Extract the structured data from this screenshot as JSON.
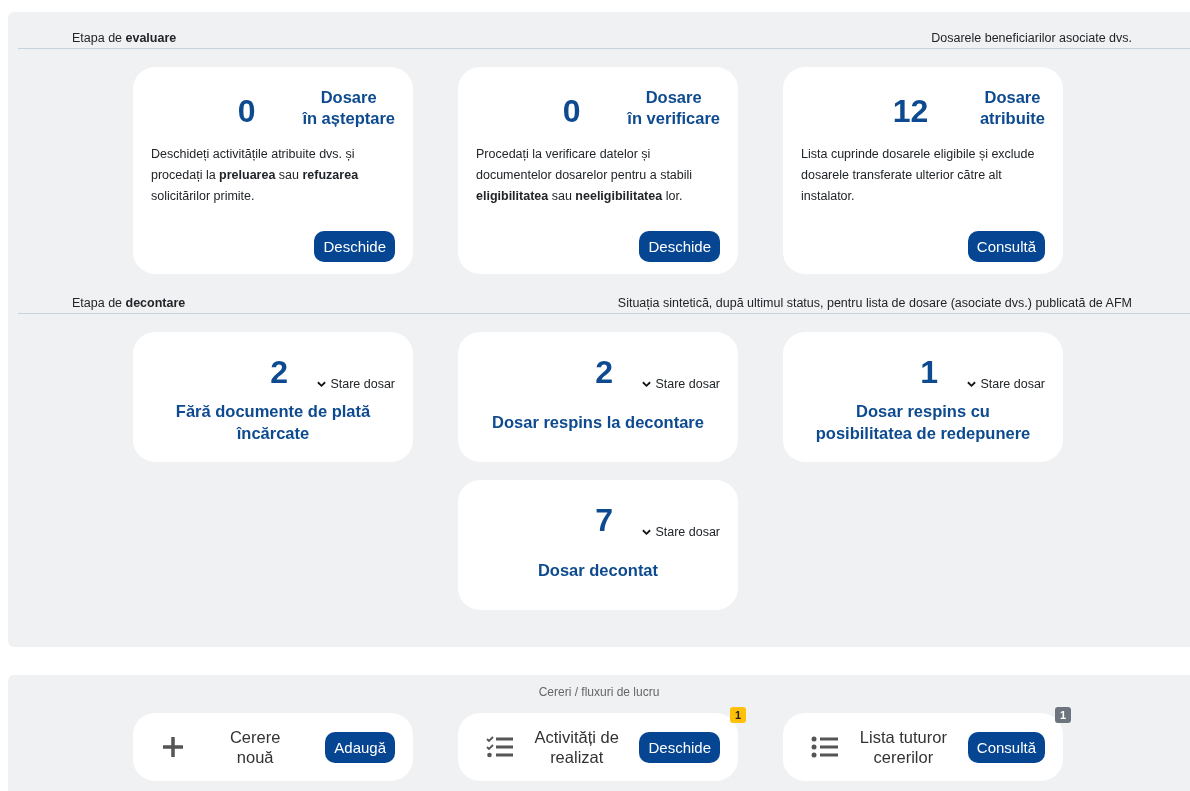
{
  "evaluation": {
    "label": "Etapa de **evaluare**",
    "note": "Dosarele beneficiarilor asociate dvs.",
    "cards": [
      {
        "count": "0",
        "title": "Dosare\nîn așteptare",
        "description": "Deschideți activitățile atribuite dvs. și procedați la **preluarea** sau **refuzarea** solicitărilor primite.",
        "button": "Deschide"
      },
      {
        "count": "0",
        "title": "Dosare\nîn verificare",
        "description": "Procedați la verificare datelor și documentelor dosarelor pentru a stabili **eligibilitatea** sau **neeligibilitatea** lor.",
        "button": "Deschide"
      },
      {
        "count": "12",
        "title": "Dosare\natribuite",
        "description": "Lista cuprinde dosarele eligibile și exclude dosarele transferate ulterior către alt instalator.",
        "button": "Consultă"
      }
    ]
  },
  "settlement": {
    "label": "Etapa de **decontare**",
    "note": "Situația sintetică, după ultimul status, pentru lista de dosare (asociate dvs.) publicată de AFM",
    "cards": [
      {
        "count": "2",
        "toggle": "Stare dosar",
        "title": "Fără documente de plată\nîncărcate"
      },
      {
        "count": "2",
        "toggle": "Stare dosar",
        "title": "Dosar respins la decontare"
      },
      {
        "count": "1",
        "toggle": "Stare dosar",
        "title": "Dosar respins cu\nposibilitatea de redepunere"
      },
      {
        "count": "7",
        "toggle": "Stare dosar",
        "title": "Dosar decontat"
      }
    ]
  },
  "workflows": {
    "title": "Cereri / fluxuri de lucru",
    "cards": [
      {
        "kind": "plus",
        "label": "Cerere\nnouă",
        "button": "Adaugă"
      },
      {
        "kind": "checklist",
        "label": "Activități de\nrealizat",
        "button": "Deschide",
        "badge": {
          "text": "1",
          "color": "#ffc107"
        }
      },
      {
        "kind": "list",
        "label": "Lista tuturor\ncererilor",
        "button": "Consultă",
        "badge": {
          "text": "1",
          "color": "#6c757d"
        }
      }
    ]
  }
}
